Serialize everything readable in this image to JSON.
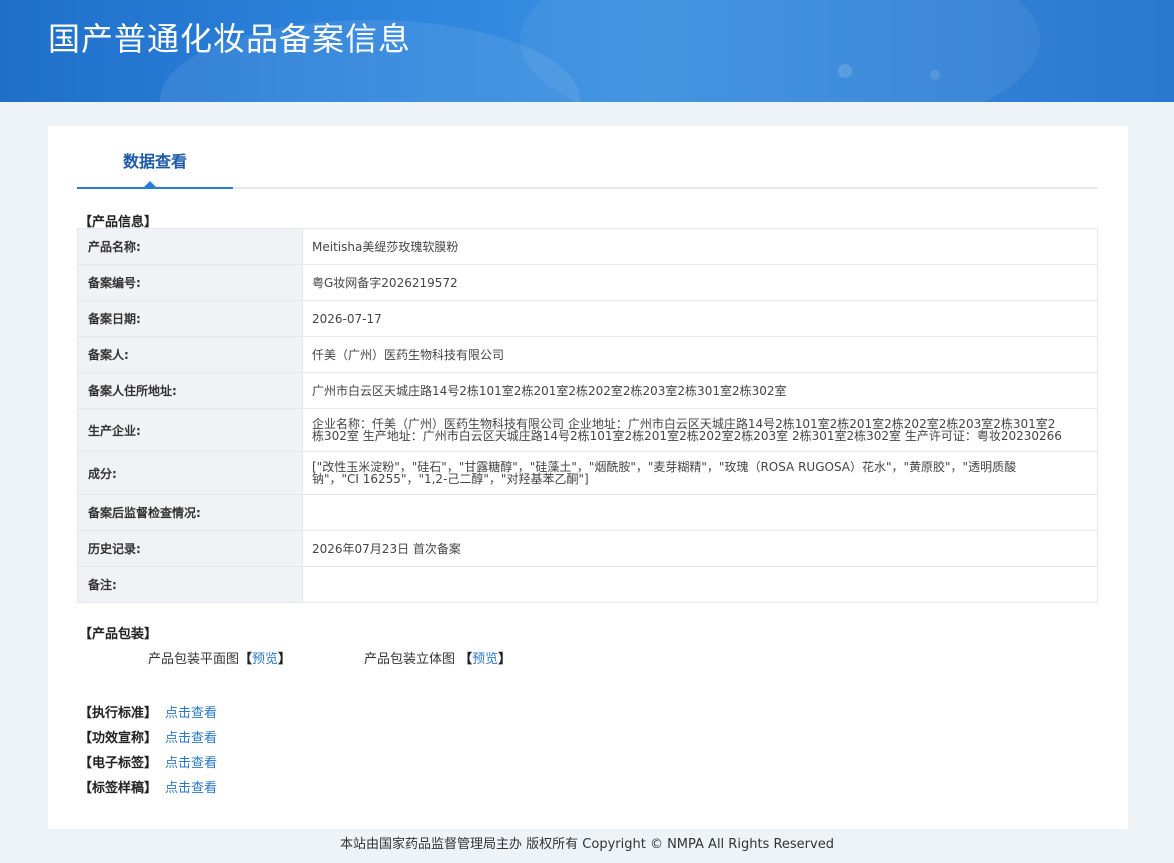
{
  "header": {
    "title": "国产普通化妆品备案信息"
  },
  "tabs": [
    {
      "label": "数据查看"
    }
  ],
  "product_section": {
    "label": "【产品信息】"
  },
  "rows": [
    {
      "key": "产品名称:",
      "value": "Meitisha美缇莎玫瑰软膜粉"
    },
    {
      "key": "备案编号:",
      "value": "粤G妆网备字2026219572"
    },
    {
      "key": "备案日期:",
      "value": "2026-07-17"
    },
    {
      "key": "备案人:",
      "value": "仟美（广州）医药生物科技有限公司"
    },
    {
      "key": "备案人住所地址:",
      "value": "广州市白云区天城庄路14号2栋101室2栋201室2栋202室2栋203室2栋301室2栋302室"
    },
    {
      "key": "生产企业:",
      "value_line1": "企业名称：仟美（广州）医药生物科技有限公司 企业地址：广州市白云区天城庄路14号2栋101室2栋201室2栋202室2栋203室2栋301室2",
      "value_line2": "栋302室 生产地址：广州市白云区天城庄路14号2栋101室2栋201室2栋202室2栋203室 2栋301室2栋302室 生产许可证：粤妆20230266"
    },
    {
      "key": "成分:",
      "value_line1": "[\"改性玉米淀粉\"，\"硅石\"，\"甘露糖醇\"，\"硅藻土\"，\"烟酰胺\"，\"麦芽糊精\"，\"玫瑰（ROSA RUGOSA）花水\"，\"黄原胶\"，\"透明质酸",
      "value_line2": "钠\"，\"CI 16255\"，\"1,2-己二醇\"，\"对羟基苯乙酮\"]"
    },
    {
      "key": "备案后监督检查情况:",
      "value": ""
    },
    {
      "key": "历史记录:",
      "value": "2026年07月23日 首次备案"
    },
    {
      "key": "备注:",
      "value": ""
    }
  ],
  "packaging": {
    "label": "【产品包装】",
    "flat": {
      "label": "产品包装平面图",
      "open": "【",
      "link": "预览",
      "close": "】"
    },
    "solid": {
      "label": "产品包装立体图 ",
      "open": "【",
      "link": "预览",
      "close": "】"
    }
  },
  "standards": [
    {
      "label": "【执行标准】",
      "link": "点击查看"
    },
    {
      "label": "【功效宣称】",
      "link": "点击查看"
    },
    {
      "label": "【电子标签】",
      "link": "点击查看"
    },
    {
      "label": "【标签样稿】",
      "link": "点击查看"
    }
  ],
  "footer": {
    "text": "本站由国家药品监督管理局主办 版权所有 Copyright © NMPA All Rights Reserved"
  },
  "colors": {
    "banner": "#2a7dd4",
    "tab_active": "#1d5aa8",
    "link": "#2a79c7",
    "page_bg": "#eef3f7"
  }
}
